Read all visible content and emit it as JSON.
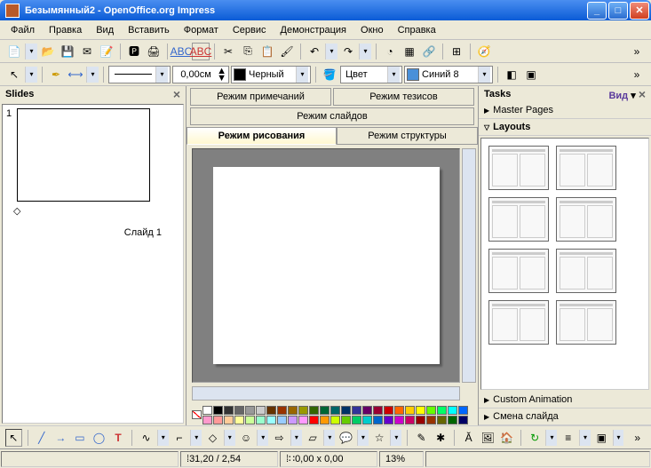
{
  "title": "Безымянный2 - OpenOffice.org Impress",
  "menu": [
    "Файл",
    "Правка",
    "Вид",
    "Вставить",
    "Формат",
    "Сервис",
    "Демонстрация",
    "Окно",
    "Справка"
  ],
  "toolbar2": {
    "width": "0,00см",
    "lineColor": "Черный",
    "fillMethod": "Цвет",
    "fillColor": "Синий 8",
    "fillHex": "#4a90d9"
  },
  "slides": {
    "header": "Slides",
    "items": [
      {
        "num": "1",
        "label": "Слайд 1"
      }
    ]
  },
  "modes": {
    "notes": "Режим примечаний",
    "theses": "Режим тезисов",
    "slides": "Режим слайдов",
    "drawing": "Режим рисования",
    "structure": "Режим структуры"
  },
  "tasks": {
    "header": "Tasks",
    "view": "Вид",
    "sections": {
      "master": "Master Pages",
      "layouts": "Layouts",
      "anim": "Custom Animation",
      "trans": "Смена слайда"
    }
  },
  "palette_top": [
    "#ffffff",
    "#000000",
    "#333333",
    "#666666",
    "#999999",
    "#cccccc",
    "#663300",
    "#993300",
    "#996600",
    "#999900",
    "#336600",
    "#006633",
    "#006666",
    "#003366",
    "#333399",
    "#660066",
    "#990033",
    "#cc0000",
    "#ff6600",
    "#ffcc00",
    "#ffff00",
    "#66ff00",
    "#00ff66",
    "#00ffff",
    "#0066ff"
  ],
  "palette_bot": [
    "#ff99cc",
    "#ff9999",
    "#ffcc99",
    "#ffff99",
    "#ccff99",
    "#99ffcc",
    "#99ffff",
    "#99ccff",
    "#cc99ff",
    "#ff99ff",
    "#ff0000",
    "#ff9900",
    "#ccff00",
    "#66cc00",
    "#00cc66",
    "#00cccc",
    "#0066cc",
    "#6600cc",
    "#cc00cc",
    "#cc0066",
    "#990000",
    "#993300",
    "#666600",
    "#006600",
    "#000066"
  ],
  "status": {
    "pos": "31,20 / 2,54",
    "size": "0,00 x 0,00",
    "zoom": "13%"
  }
}
